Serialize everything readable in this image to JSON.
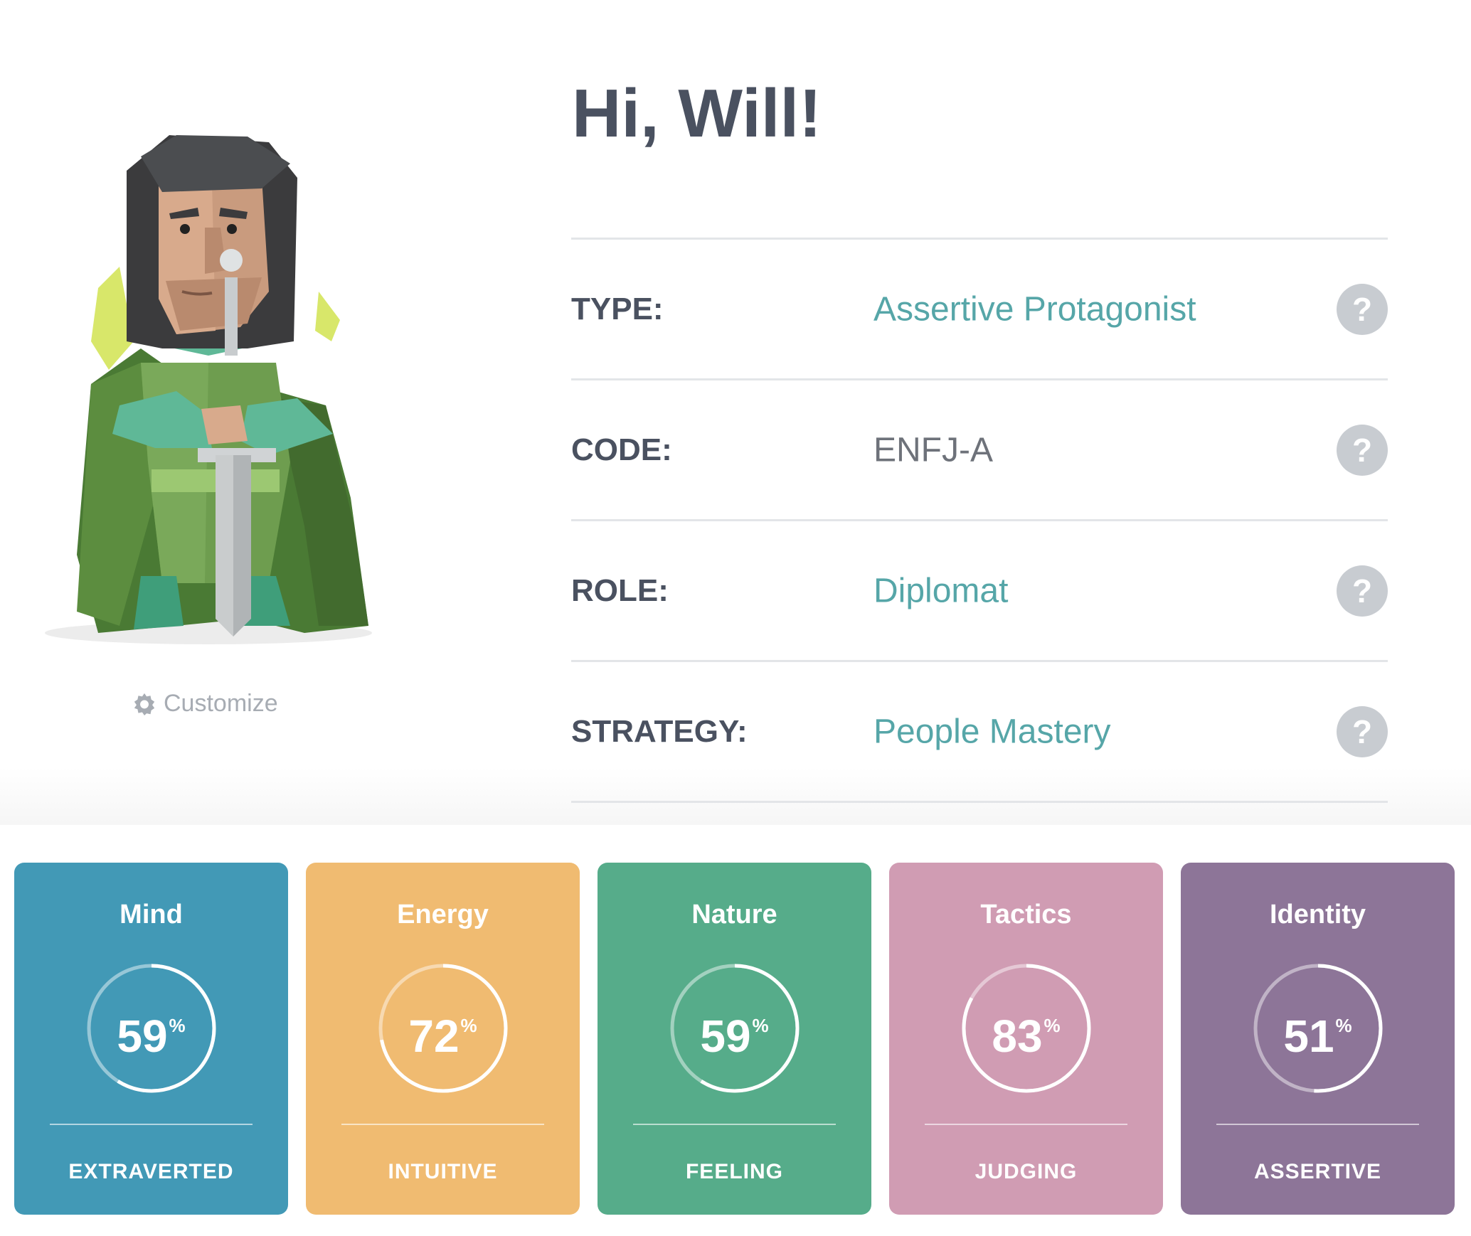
{
  "greeting": "Hi, Will!",
  "customize_label": "Customize",
  "profile_rows": [
    {
      "label": "TYPE:",
      "value": "Assertive Protagonist"
    },
    {
      "label": "CODE:",
      "value": "ENFJ-A"
    },
    {
      "label": "ROLE:",
      "value": "Diplomat"
    },
    {
      "label": "STRATEGY:",
      "value": "People Mastery"
    }
  ],
  "help_glyph": "?",
  "traits": [
    {
      "title": "Mind",
      "percent": 59,
      "percent_text": "59",
      "trait": "EXTRAVERTED",
      "color": "#4299b6"
    },
    {
      "title": "Energy",
      "percent": 72,
      "percent_text": "72",
      "trait": "INTUITIVE",
      "color": "#f0bb71"
    },
    {
      "title": "Nature",
      "percent": 59,
      "percent_text": "59",
      "trait": "FEELING",
      "color": "#56ac8a"
    },
    {
      "title": "Tactics",
      "percent": 83,
      "percent_text": "83",
      "trait": "JUDGING",
      "color": "#d09cb3"
    },
    {
      "title": "Identity",
      "percent": 51,
      "percent_text": "51",
      "trait": "ASSERTIVE",
      "color": "#8d7598"
    }
  ],
  "percent_sign": "%",
  "icons": {
    "customize": "gear-icon",
    "help": "question-mark-icon"
  }
}
